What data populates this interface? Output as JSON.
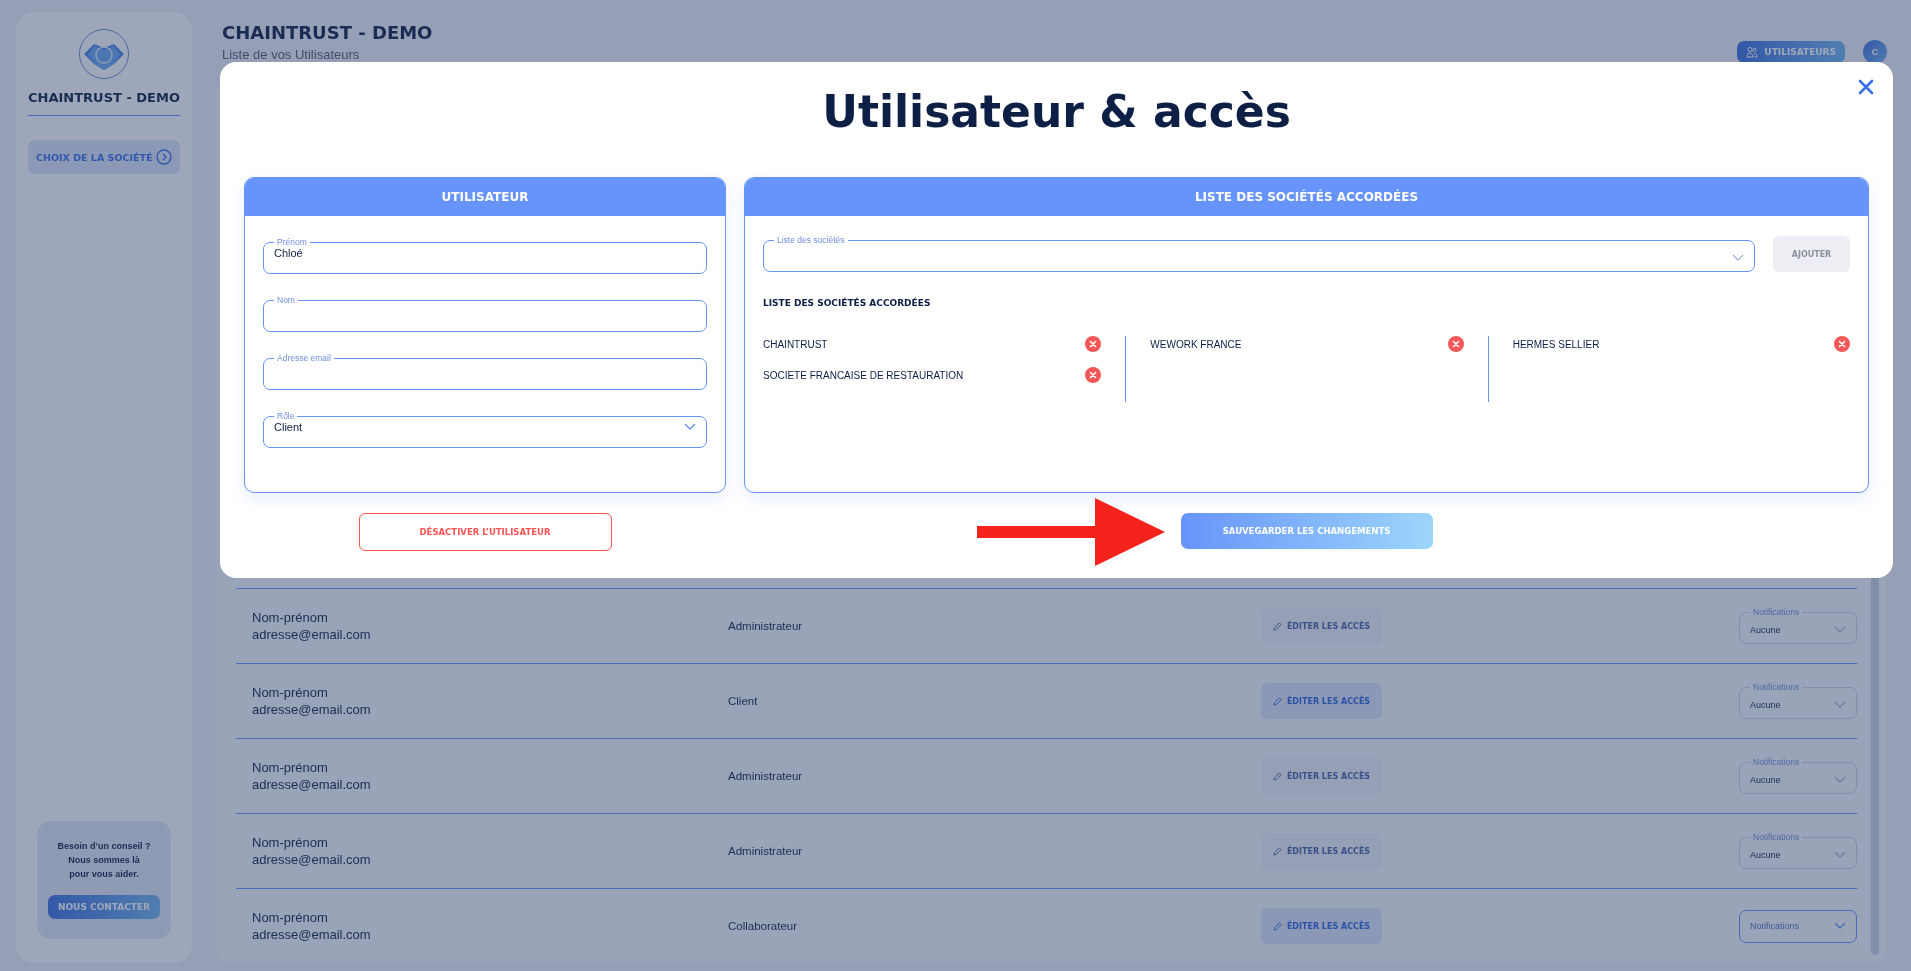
{
  "sidebar": {
    "brand": "CHAINTRUST - DEMO",
    "nav_items": [
      {
        "label": "CHOIX DE LA SOCIÉTÉ",
        "selected": true
      }
    ],
    "help": {
      "text": "Besoin d’un conseil ?\nNous sommes là\npour vous aider.",
      "button": "NOUS CONTACTER"
    }
  },
  "header": {
    "title": "CHAINTRUST - DEMO",
    "subtitle": "Liste de vos Utilisateurs",
    "users_button": "UTILISATEURS",
    "avatar": "C"
  },
  "table": {
    "rows": [
      {
        "name": "Nom-prénom",
        "email": "adresse@email.com",
        "role": "Administrateur",
        "edit_button": {
          "label": "ÉDITER LES ACCÈS",
          "disabled": true
        },
        "notifications": {
          "label": "Notifications",
          "value": "Aucune",
          "disabled": true
        }
      },
      {
        "name": "Nom-prénom",
        "email": "adresse@email.com",
        "role": "Client",
        "edit_button": {
          "label": "ÉDITER LES ACCÈS",
          "disabled": false
        },
        "notifications": {
          "label": "Notifications",
          "value": "Aucune",
          "disabled": true
        }
      },
      {
        "name": "Nom-prénom",
        "email": "adresse@email.com",
        "role": "Administrateur",
        "edit_button": {
          "label": "ÉDITER LES ACCÈS",
          "disabled": true
        },
        "notifications": {
          "label": "Notifications",
          "value": "Aucune",
          "disabled": true
        }
      },
      {
        "name": "Nom-prénom",
        "email": "adresse@email.com",
        "role": "Administrateur",
        "edit_button": {
          "label": "ÉDITER LES ACCÈS",
          "disabled": true
        },
        "notifications": {
          "label": "Notifications",
          "value": "Aucune",
          "disabled": true
        }
      },
      {
        "name": "Nom-prénom",
        "email": "adresse@email.com",
        "role": "Collaborateur",
        "edit_button": {
          "label": "ÉDITER LES ACCÈS",
          "disabled": false
        },
        "notifications": {
          "placeholder": "Notifications",
          "disabled": false
        }
      }
    ]
  },
  "modal": {
    "title": "Utilisateur & accès",
    "user_card": {
      "heading": "UTILISATEUR",
      "fields": [
        {
          "kind": "text",
          "label": "Prénom",
          "value": "Chloé"
        },
        {
          "kind": "text",
          "label": "Nom"
        },
        {
          "kind": "text",
          "label": "Adresse email"
        },
        {
          "kind": "select",
          "label": "Rôle",
          "value": "Client"
        }
      ]
    },
    "deactivate_button": "DÉSACTIVER L’UTILISATEUR",
    "companies_card": {
      "heading": "LISTE DES SOCIÉTÉS ACCORDÉES",
      "select": {
        "label": "Liste des sociétés"
      },
      "add_button": {
        "label": "AJOUTER",
        "disabled": true
      },
      "list_title": "LISTE DES SOCIÉTÉS ACCORDÉES",
      "columns": [
        {
          "companies": [
            "CHAINTRUST",
            "SOCIETE FRANCAISE DE RESTAURATION"
          ]
        },
        {
          "companies": [
            "WEWORK FRANCE"
          ]
        },
        {
          "companies": [
            "HERMES SELLIER"
          ]
        }
      ]
    },
    "save_button": "SAUVEGARDER LES CHANGEMENTS"
  }
}
